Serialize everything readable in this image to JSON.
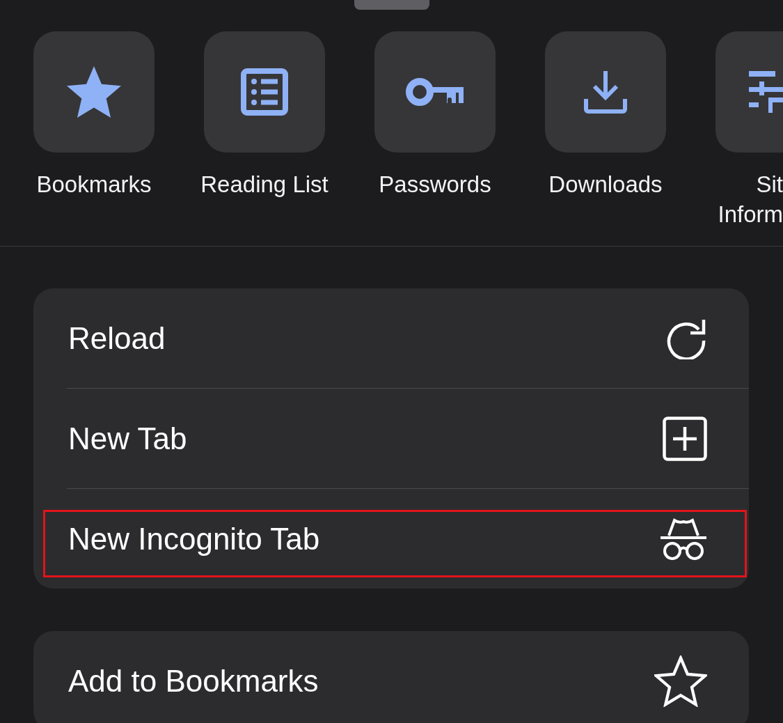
{
  "shortcuts": [
    {
      "label": "Bookmarks"
    },
    {
      "label": "Reading List"
    },
    {
      "label": "Passwords"
    },
    {
      "label": "Downloads"
    },
    {
      "label": "Sit Inform"
    }
  ],
  "menu_groups": [
    {
      "items": [
        {
          "label": "Reload",
          "highlighted": false
        },
        {
          "label": "New Tab",
          "highlighted": false
        },
        {
          "label": "New Incognito Tab",
          "highlighted": true
        }
      ]
    },
    {
      "items": [
        {
          "label": "Add to Bookmarks",
          "highlighted": false
        }
      ]
    }
  ]
}
